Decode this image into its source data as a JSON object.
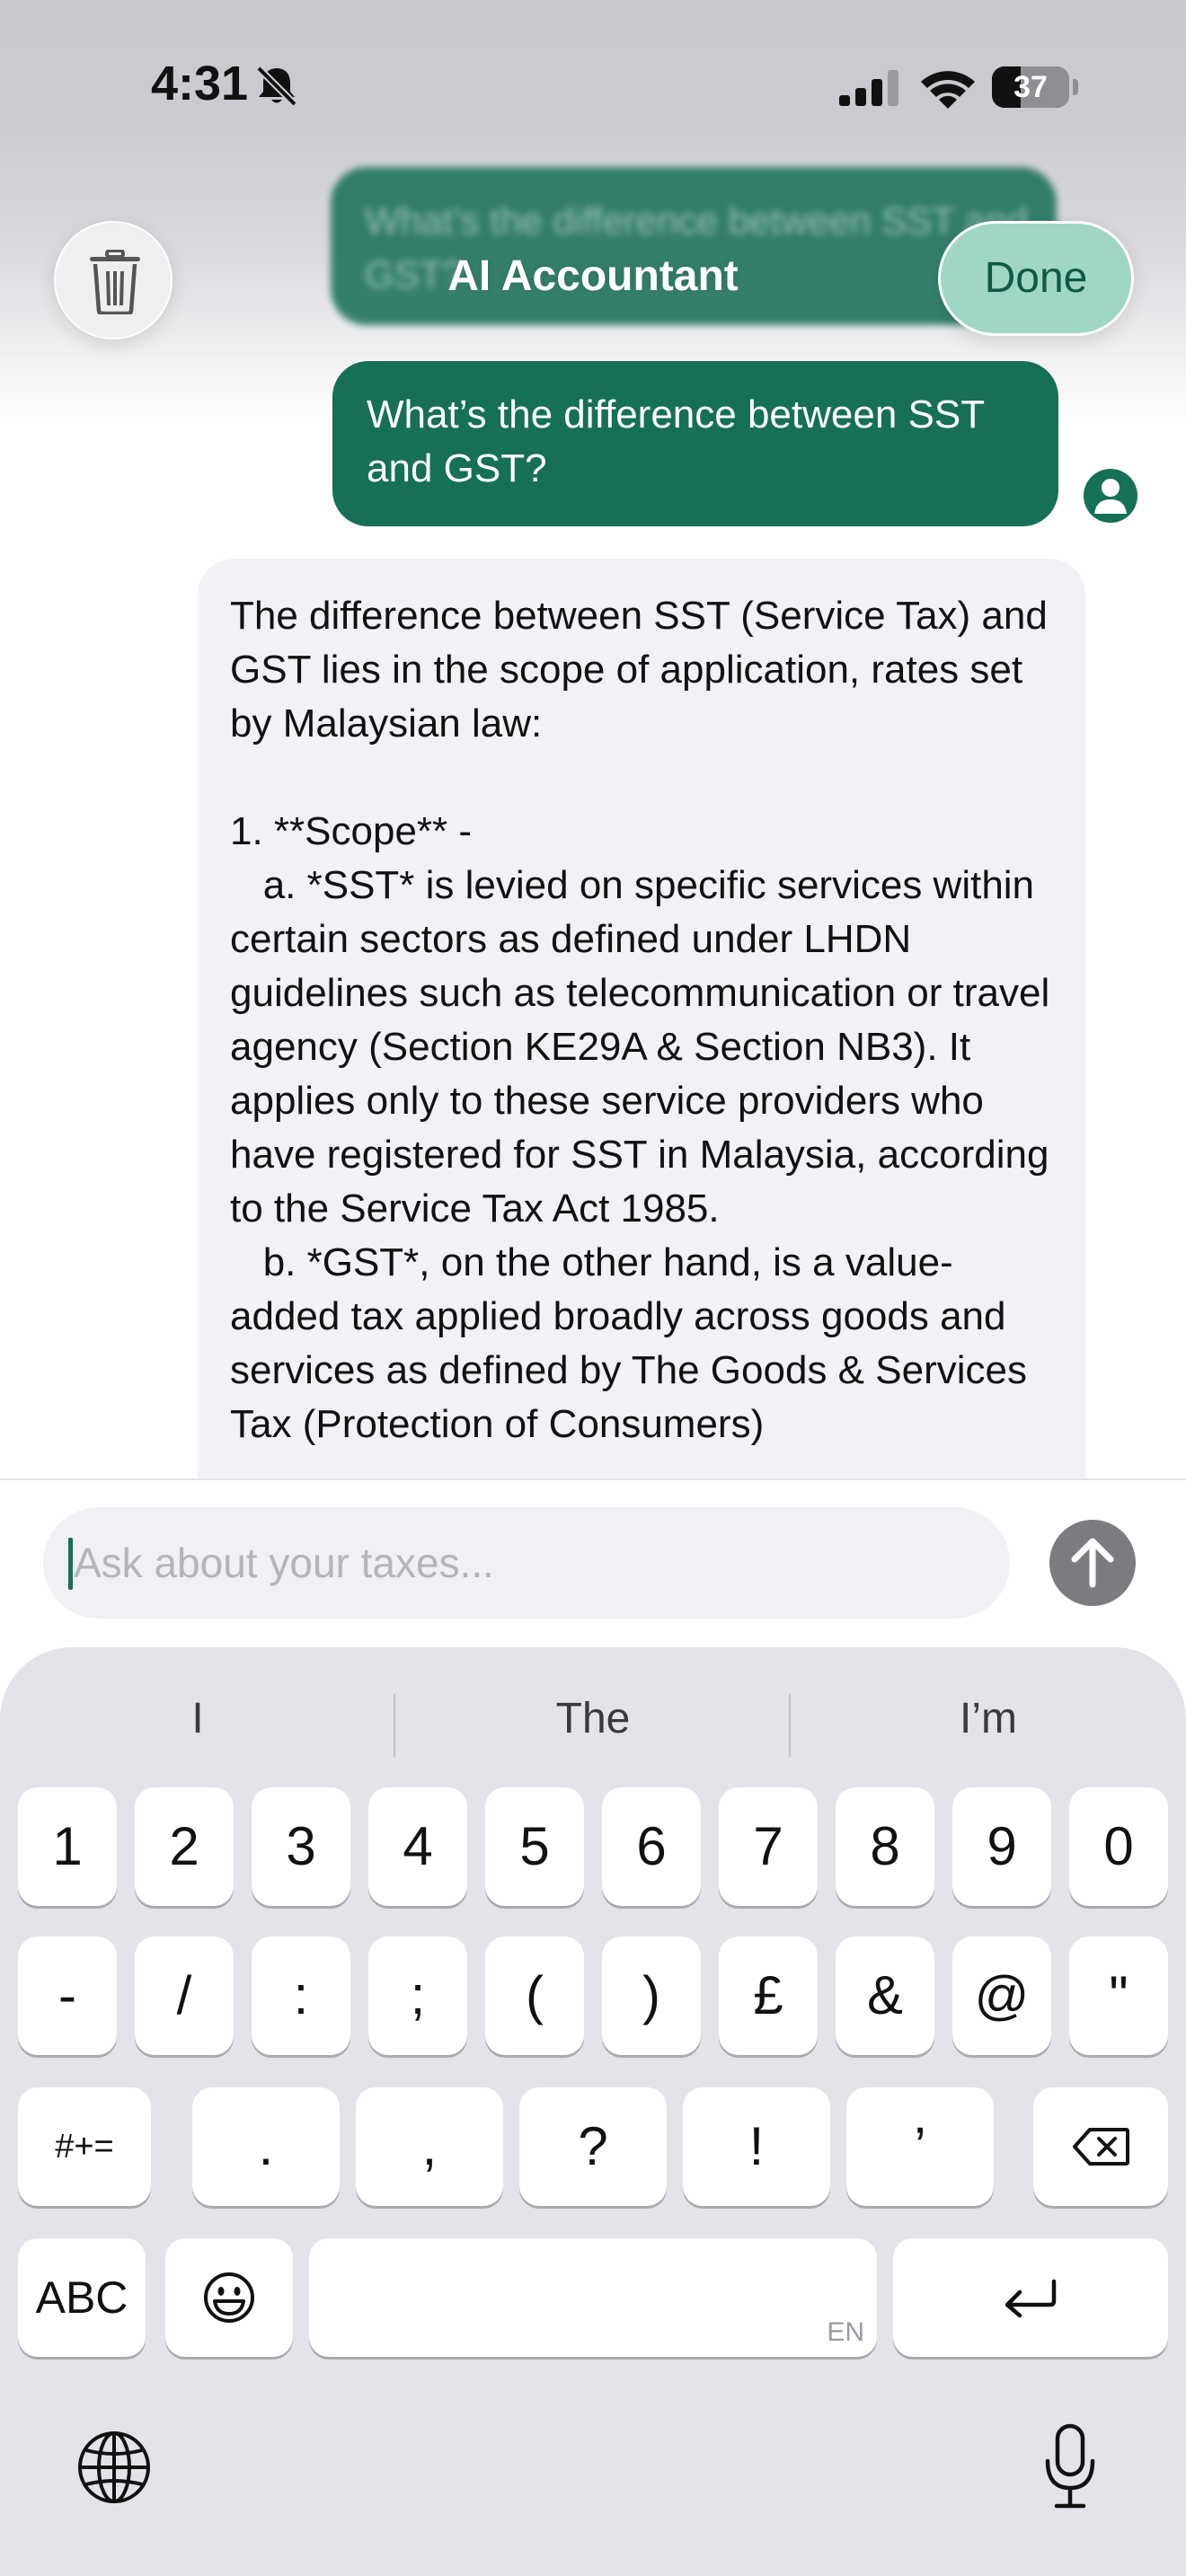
{
  "status_bar": {
    "time": "4:31",
    "battery": "37",
    "battery_level_percent": 37
  },
  "header": {
    "title": "AI Accountant",
    "done_label": "Done",
    "background_bubble_text": "What’s the difference between SST and GST?"
  },
  "chat": {
    "user_message": "What’s the difference between SST and GST?",
    "ai_message": "The difference between SST (Service Tax) and GST lies in the scope of application, rates set by Malaysian law:\n\n1. **Scope** -\n   a. *SST* is levied on specific services within certain sectors as defined under LHDN guidelines such as telecommunication or travel agency (Section KE29A & Section NB3). It applies only to these service providers who have registered for SST in Malaysia, according to the Service Tax Act 1985.\n   b. *GST*, on the other hand, is a value-added tax applied broadly across goods and services as defined by The Goods & Services Tax (Protection of Consumers)"
  },
  "input": {
    "placeholder": "Ask about your taxes..."
  },
  "keyboard": {
    "suggestions": [
      "I",
      "The",
      "I’m"
    ],
    "row1": [
      "1",
      "2",
      "3",
      "4",
      "5",
      "6",
      "7",
      "8",
      "9",
      "0"
    ],
    "row2": [
      "-",
      "/",
      ":",
      ";",
      "(",
      ")",
      "£",
      "&",
      "@",
      "\""
    ],
    "row3_left": "#+=",
    "row3_mid": [
      ".",
      ",",
      "?",
      "!",
      "’"
    ],
    "abc_label": "ABC",
    "language_indicator": "EN",
    "icons": {
      "delete": "backspace-icon",
      "return": "return-icon",
      "emoji": "emoji-icon",
      "globe": "globe-icon",
      "mic": "microphone-icon"
    }
  },
  "colors": {
    "accent": "#166f57",
    "done_bg": "#9fd6c4",
    "ai_bubble": "#f1f1f6",
    "keyboard_bg": "#e3e4e9",
    "send_button": "#7c7c80"
  }
}
